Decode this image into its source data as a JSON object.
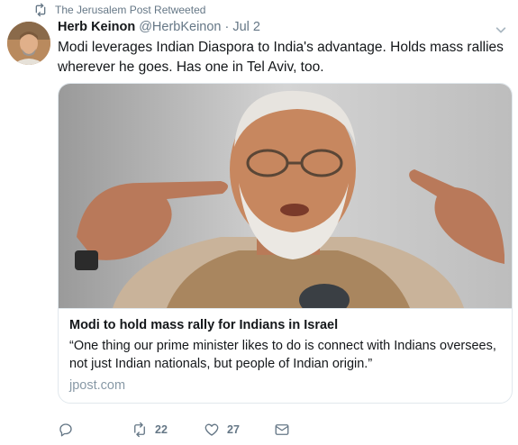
{
  "retweet": {
    "label": "The Jerusalem Post Retweeted"
  },
  "tweet": {
    "author_name": "Herb Keinon",
    "author_handle": "@HerbKeinon",
    "separator": "·",
    "date": "Jul 2",
    "text": "Modi leverages Indian Diaspora to India's advantage. Holds mass rallies wherever he goes. Has one in Tel Aviv, too."
  },
  "card": {
    "title": "Modi to hold mass rally for Indians in Israel",
    "description": "“One thing our prime minister likes to do is connect with Indians oversees, not just Indian nationals, but people of Indian origin.”",
    "domain": "jpost.com"
  },
  "actions": {
    "reply_count": "",
    "retweet_count": "22",
    "like_count": "27"
  },
  "colors": {
    "secondary_text": "#657786",
    "card_border": "#e1e8ed",
    "domain_text": "#8899a6"
  },
  "icons": [
    "retweet-icon",
    "chevron-down-icon",
    "reply-icon",
    "like-icon",
    "direct-message-icon"
  ]
}
